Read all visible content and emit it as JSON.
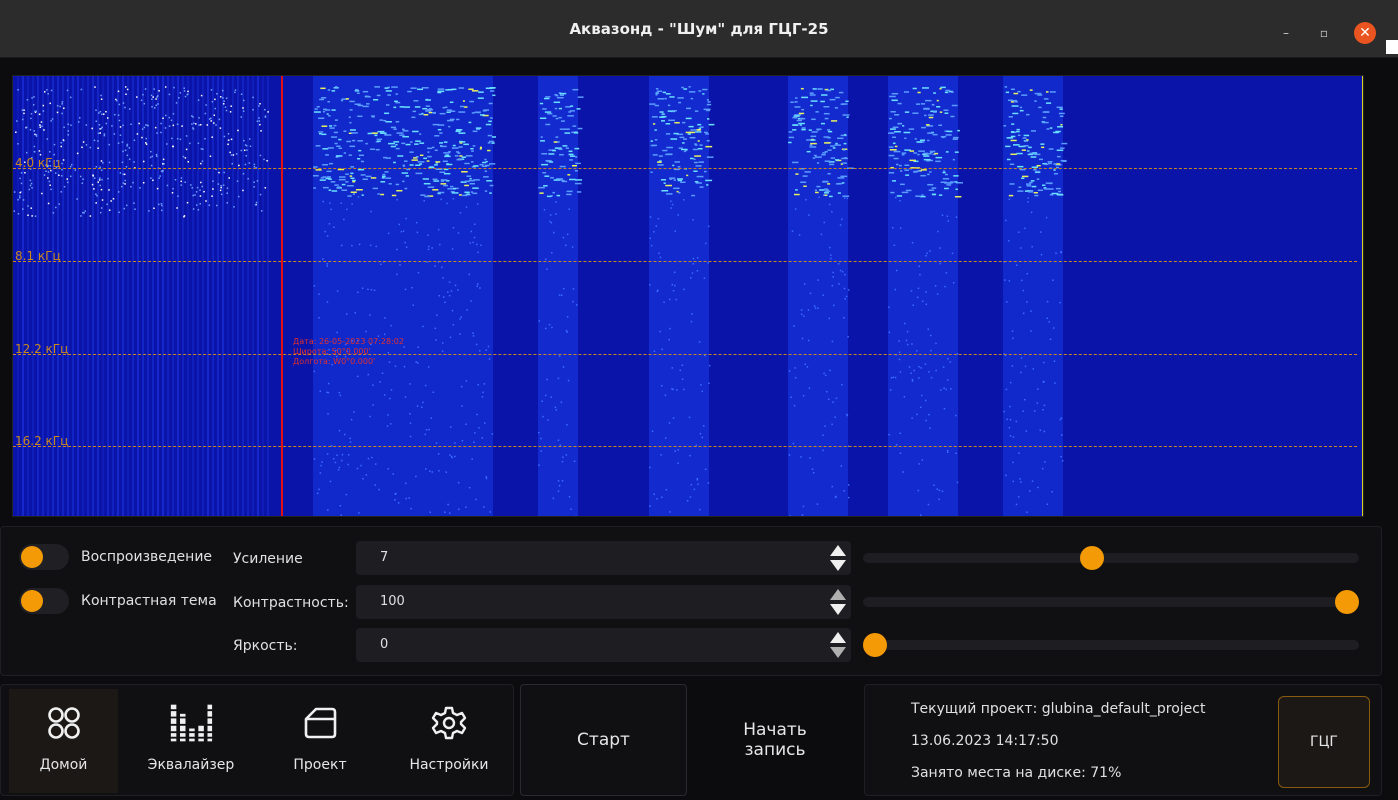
{
  "window": {
    "title": "Аквазонд  - \"Шум\" для ГЦГ-25",
    "minimize_label": "–",
    "restore_label": "▫",
    "close_label": "✕"
  },
  "spectrogram": {
    "frequency_labels": [
      "4.0 кГц",
      "8.1 кГц",
      "12.2 кГц",
      "16.2 кГц"
    ],
    "cursor_info": {
      "date": "Дата: 26-05-2023 07:28:02",
      "latitude": "Широта: S0°0.000'",
      "longitude": "Долгота: W0°0.000'"
    }
  },
  "controls": {
    "playback_label": "Воспроизведение",
    "contrast_theme_label": "Контрастная тема",
    "gain": {
      "label": "Усиление",
      "value": "7",
      "slider_fraction": 0.46
    },
    "contrast": {
      "label": "Контрастность:",
      "value": "100",
      "slider_fraction": 1.0
    },
    "brightness": {
      "label": "Яркость:",
      "value": "0",
      "slider_fraction": 0.0
    },
    "accent_color": "#f39a06"
  },
  "nav": {
    "home": "Домой",
    "equalizer": "Эквалайзер",
    "project": "Проект",
    "settings": "Настройки"
  },
  "actions": {
    "start": "Старт",
    "record": "Начать запись"
  },
  "info": {
    "project": "Текущий проект: glubina_default_project",
    "datetime": "13.06.2023  14:17:50",
    "disk": "Занято места на диске: 71%",
    "gcg_button": "ГЦГ"
  }
}
